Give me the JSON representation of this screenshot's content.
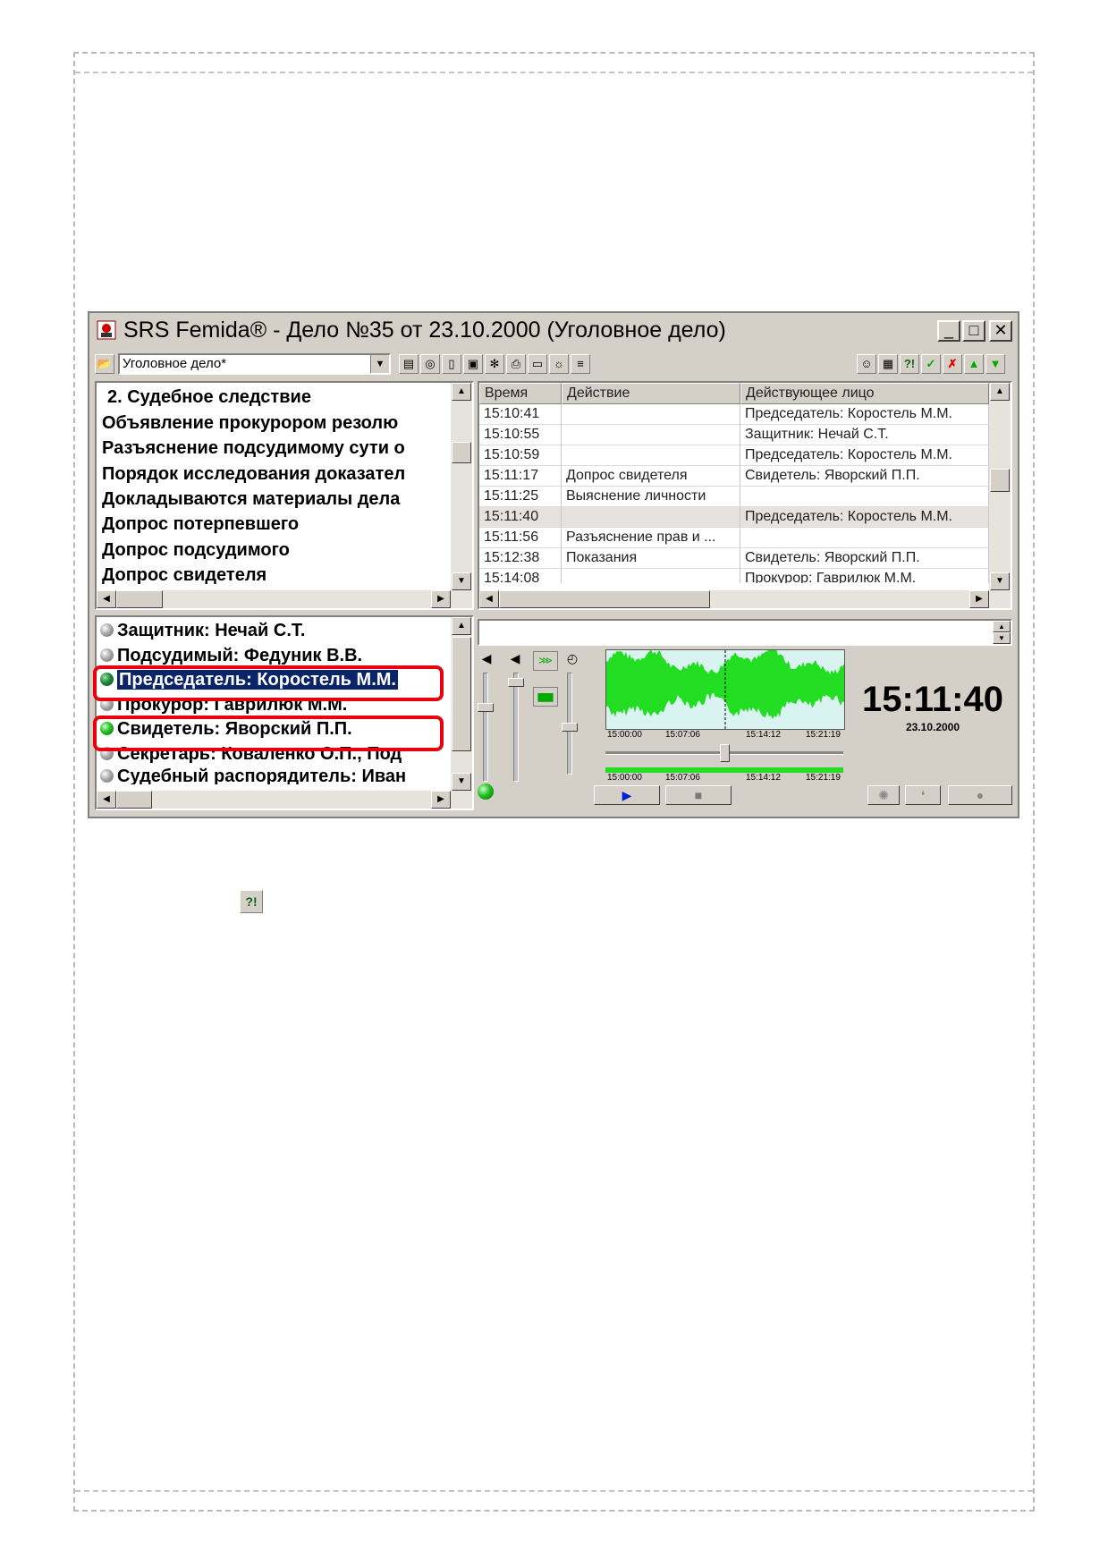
{
  "window": {
    "title": "SRS Femida® - Дело №35 от 23.10.2000 (Уголовное дело)",
    "minimize": "_",
    "maximize": "□",
    "close": "✕"
  },
  "toolbar": {
    "case_type_value": "Уголовное дело*",
    "combo_arrow": "▼"
  },
  "agenda": {
    "items": [
      "2. Судебное следствие",
      "Объявление прокурором резолю",
      "Разъяснение подсудимому сути о",
      "Порядок исследования доказател",
      "Докладываются материалы дела",
      "Допрос потерпевшего",
      "Допрос подсудимого",
      "Допрос свидетеля"
    ]
  },
  "log": {
    "columns": [
      "Время",
      "Действие",
      "Действующее лицо"
    ],
    "rows": [
      {
        "time": "15:10:41",
        "action": "",
        "person": "Председатель: Коростель М.М."
      },
      {
        "time": "15:10:55",
        "action": "",
        "person": "Защитник: Нечай С.Т."
      },
      {
        "time": "15:10:59",
        "action": "",
        "person": "Председатель: Коростель М.М."
      },
      {
        "time": "15:11:17",
        "action": "Допрос свидетеля",
        "person": "Свидетель: Яворский П.П."
      },
      {
        "time": "15:11:25",
        "action": "Выяснение личности",
        "person": ""
      },
      {
        "time": "15:11:40",
        "action": "",
        "person": "Председатель: Коростель М.М."
      },
      {
        "time": "15:11:56",
        "action": "Разъяснение прав и ...",
        "person": ""
      },
      {
        "time": "15:12:38",
        "action": "Показания",
        "person": "Свидетель: Яворский П.П."
      },
      {
        "time": "15:14:08",
        "action": "",
        "person": "Прокурор: Гаврилюк М.М."
      }
    ]
  },
  "participants": {
    "items": [
      "Защитник: Нечай С.Т.",
      "Подсудимый: Федуник В.В.",
      "Председатель: Коростель М.М.",
      "Прокурор: Гаврилюк М.М.",
      "Свидетель: Яворский П.П.",
      "Секретарь: Коваленко О.П., Под",
      "Судебный распорядитель: Иван"
    ]
  },
  "waveform": {
    "ticks": [
      "15:00:00",
      "15:07:06",
      "15:14:12",
      "15:21:19"
    ],
    "ticks2": [
      "15:00:00",
      "15:07:06",
      "15:14:12",
      "15:21:19"
    ],
    "position_fraction": 0.5
  },
  "clock": {
    "time": "15:11:40",
    "date": "23.10.2000"
  },
  "transport": {
    "play": "▶",
    "stop": "■"
  },
  "colors": {
    "highlight": "#e8000a",
    "selection": "#0a246a",
    "wave": "#22dd22"
  }
}
